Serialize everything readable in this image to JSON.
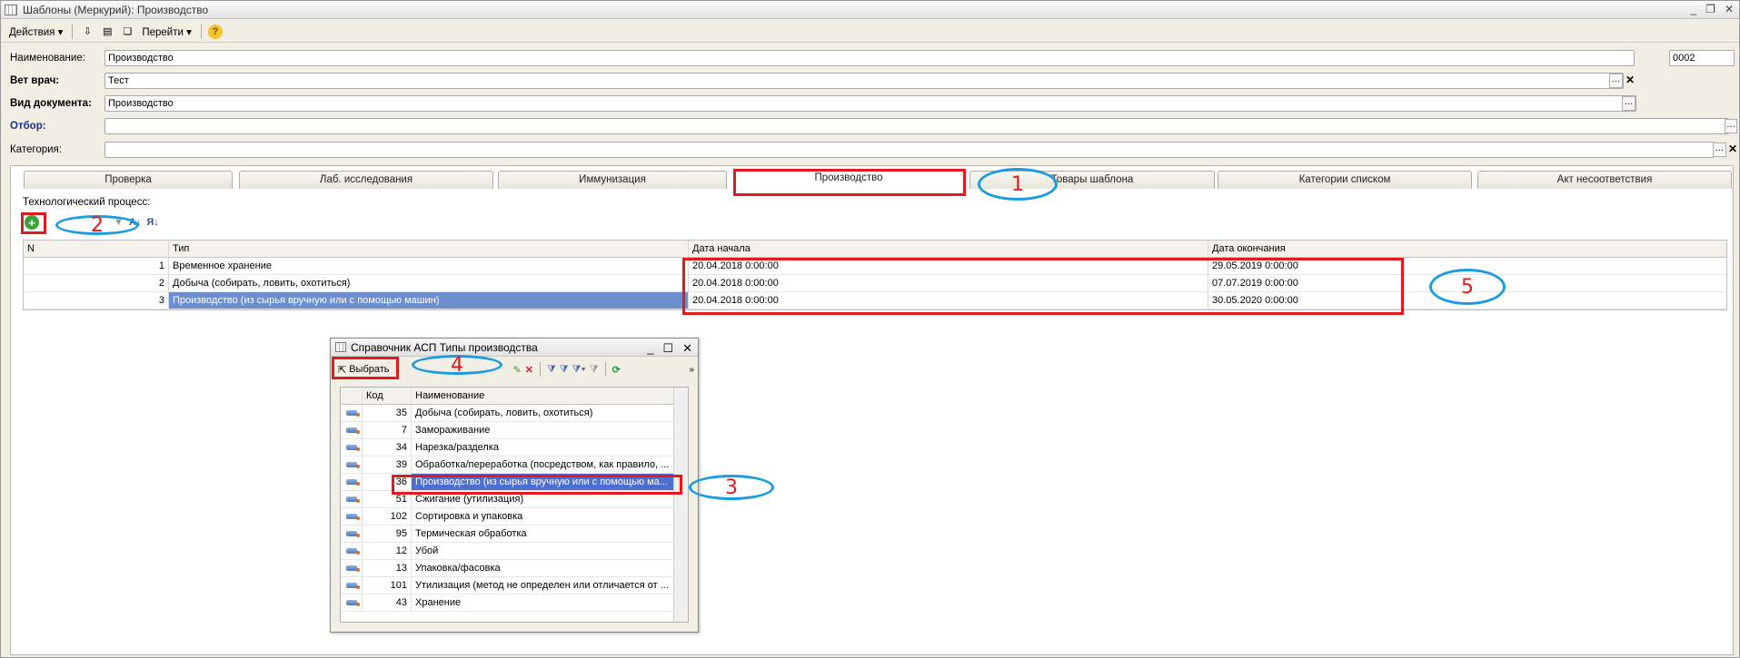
{
  "window": {
    "title": "Шаблоны (Меркурий): Производство"
  },
  "menubar": {
    "actions": "Действия",
    "goto": "Перейти"
  },
  "form": {
    "name_label": "Наименование:",
    "name_value": "Производство",
    "code_value": "0002",
    "vet_label": "Вет врач:",
    "vet_value": "Тест",
    "doctype_label": "Вид документа:",
    "doctype_value": "Производство",
    "filter_label": "Отбор:",
    "filter_value": "",
    "category_label": "Категория:",
    "category_value": ""
  },
  "tabs": [
    "Проверка",
    "Лаб. исследования",
    "Иммунизация",
    "Производство",
    "Товары шаблона",
    "Категории списком",
    "Акт несоответствия"
  ],
  "process": {
    "title": "Технологический процесс:",
    "columns": [
      "N",
      "Тип",
      "Дата начала",
      "Дата окончания"
    ],
    "rows": [
      {
        "n": "1",
        "type": "Временное хранение",
        "start": "20.04.2018 0:00:00",
        "end": "29.05.2019 0:00:00"
      },
      {
        "n": "2",
        "type": "Добыча (собирать, ловить, охотиться)",
        "start": "20.04.2018 0:00:00",
        "end": "07.07.2019 0:00:00"
      },
      {
        "n": "3",
        "type": "Производство (из сырья вручную или с помощью машин)",
        "start": "20.04.2018 0:00:00",
        "end": "30.05.2020 0:00:00"
      }
    ]
  },
  "dialog": {
    "title": "Справочник АСП Типы производства",
    "select_label": "Выбрать",
    "columns": [
      "Код",
      "Наименование"
    ],
    "rows": [
      {
        "code": "35",
        "name": "Добыча (собирать, ловить, охотиться)"
      },
      {
        "code": "7",
        "name": "Замораживание"
      },
      {
        "code": "34",
        "name": "Нарезка/разделка"
      },
      {
        "code": "39",
        "name": "Обработка/переработка (посредством, как правило, ..."
      },
      {
        "code": "36",
        "name": "Производство (из сырья вручную или с помощью ма..."
      },
      {
        "code": "51",
        "name": "Сжигание (утилизация)"
      },
      {
        "code": "102",
        "name": "Сортировка и упаковка"
      },
      {
        "code": "95",
        "name": "Термическая обработка"
      },
      {
        "code": "12",
        "name": "Убой"
      },
      {
        "code": "13",
        "name": "Упаковка/фасовка"
      },
      {
        "code": "101",
        "name": "Утилизация (метод не определен или отличается от ..."
      },
      {
        "code": "43",
        "name": "Хранение"
      }
    ]
  },
  "annotations": [
    "1",
    "2",
    "3",
    "4",
    "5"
  ],
  "colors": {
    "annotation_box": "#e3191d",
    "annotation_oval": "#1a9ce0",
    "selection": "#6d8fd0"
  }
}
